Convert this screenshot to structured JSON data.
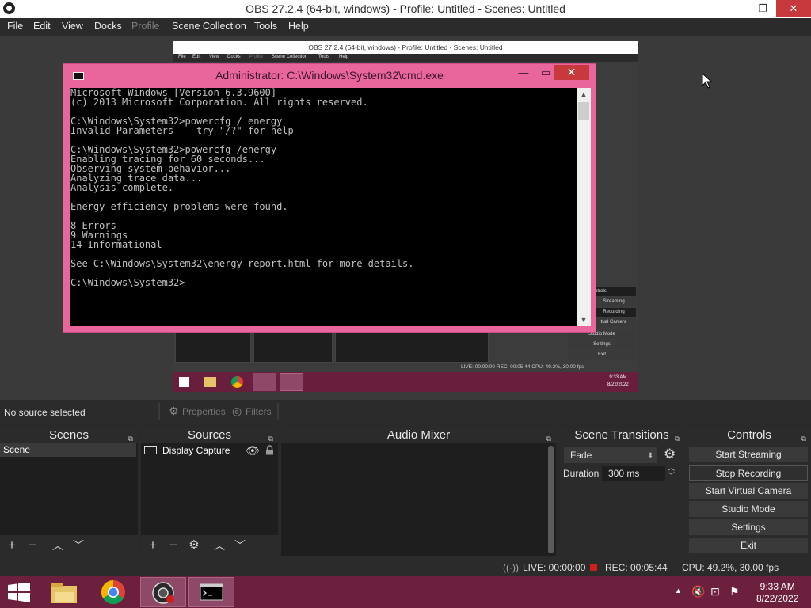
{
  "window": {
    "title": "OBS 27.2.4 (64-bit, windows) - Profile: Untitled - Scenes: Untitled",
    "minimize": "—",
    "restore": "❐",
    "close": "✕"
  },
  "menu": [
    "File",
    "Edit",
    "View",
    "Docks",
    "Profile",
    "Scene Collection",
    "Tools",
    "Help"
  ],
  "preview": {
    "inner_title": "OBS 27.2.4 (64-bit, windows) - Profile: Untitled - Scenes: Untitled",
    "inner_menu": [
      "File",
      "Edit",
      "View",
      "Docks",
      "Profile",
      "Scene Collection",
      "Tools",
      "Help"
    ],
    "inner_controls": [
      "ntrols",
      "Streaming",
      "Recording",
      "tual Camera",
      "Studio Mode",
      "Settings",
      "Exit"
    ],
    "inner_status": "LIVE: 00:00:00   REC: 00:05:44   CPU: 49.2%, 30.00 fps",
    "inner_clock_time": "9:33 AM",
    "inner_clock_date": "8/22/2022"
  },
  "cmd": {
    "title": "Administrator: C:\\Windows\\System32\\cmd.exe",
    "minimize": "—",
    "maximize": "▭",
    "close": "✕",
    "lines": [
      "Microsoft Windows [Version 6.3.9600]",
      "(c) 2013 Microsoft Corporation. All rights reserved.",
      "",
      "C:\\Windows\\System32>powercfg / energy",
      "Invalid Parameters -- try \"/?\" for help",
      "",
      "C:\\Windows\\System32>powercfg /energy",
      "Enabling tracing for 60 seconds...",
      "Observing system behavior...",
      "Analyzing trace data...",
      "Analysis complete.",
      "",
      "Energy efficiency problems were found.",
      "",
      "8 Errors",
      "9 Warnings",
      "14 Informational",
      "",
      "See C:\\Windows\\System32\\energy-report.html for more details.",
      "",
      "C:\\Windows\\System32>"
    ]
  },
  "source_toolbar": {
    "no_source": "No source selected",
    "properties": "Properties",
    "filters": "Filters"
  },
  "docks": {
    "scenes": {
      "title": "Scenes",
      "items": [
        "Scene"
      ]
    },
    "sources": {
      "title": "Sources",
      "items": [
        "Display Capture"
      ]
    },
    "mixer": {
      "title": "Audio Mixer"
    },
    "transitions": {
      "title": "Scene Transitions",
      "transition": "Fade",
      "duration_label": "Duration",
      "duration_value": "300 ms"
    },
    "controls": {
      "title": "Controls",
      "buttons": [
        "Start Streaming",
        "Stop Recording",
        "Start Virtual Camera",
        "Studio Mode",
        "Settings",
        "Exit"
      ]
    }
  },
  "status": {
    "live": "LIVE: 00:00:00",
    "rec": "REC: 00:05:44",
    "cpu": "CPU: 49.2%, 30.00 fps"
  },
  "taskbar": {
    "time": "9:33 AM",
    "date": "8/22/2022"
  },
  "colors": {
    "accent_cmd": "#e9669c",
    "taskbar": "#6d1f3e",
    "rec": "#d21d1d"
  }
}
